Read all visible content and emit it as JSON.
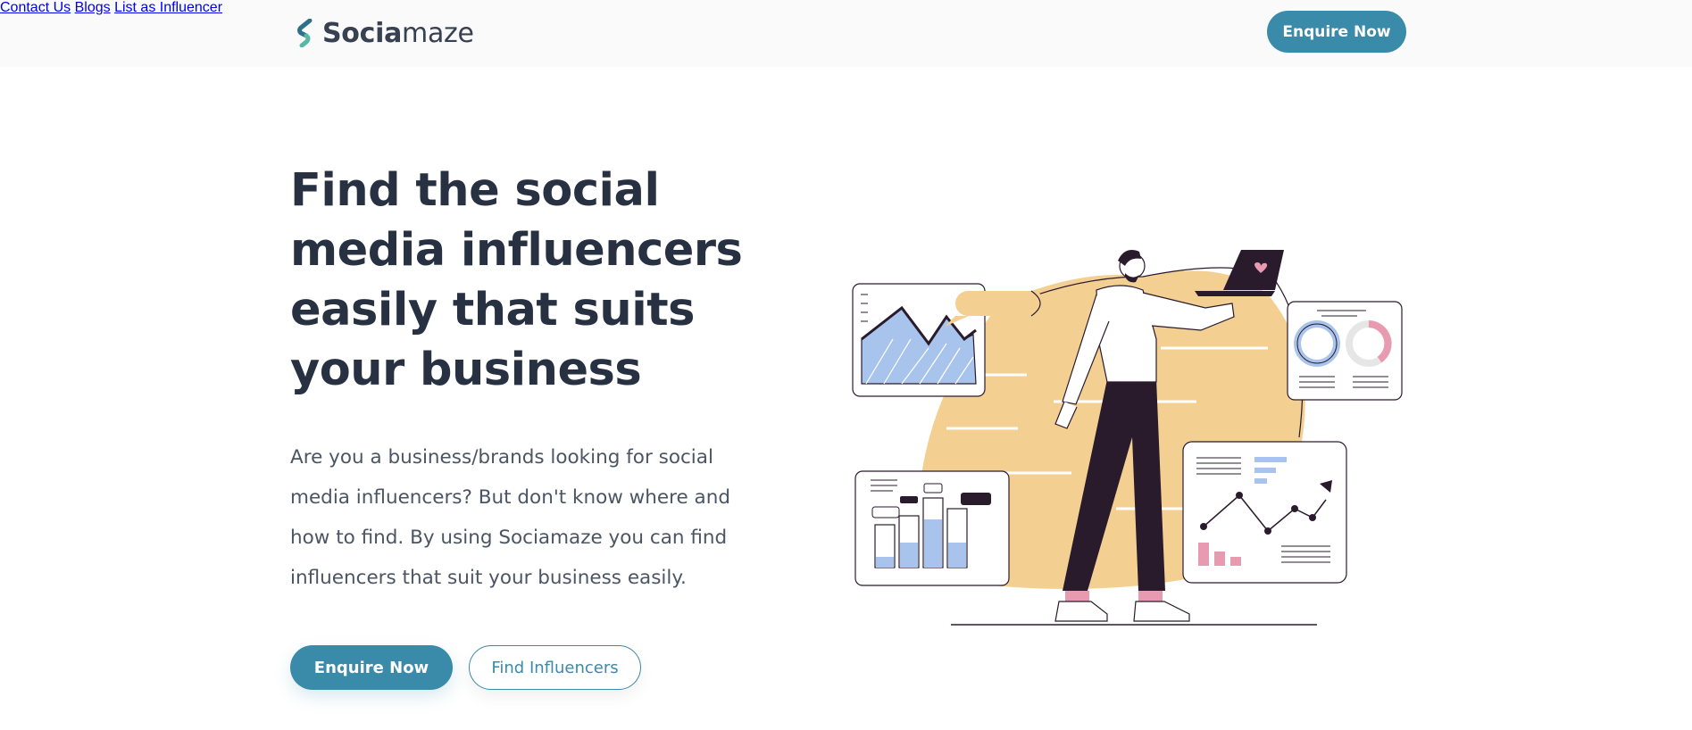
{
  "brand": {
    "name_bold": "Socia",
    "name_light": "maze",
    "accent_color": "#3a8aaa"
  },
  "nav": {
    "items": [
      {
        "label": "Contact Us"
      },
      {
        "label": "Blogs"
      },
      {
        "label": "List as Influencer"
      }
    ],
    "cta_label": "Enquire Now"
  },
  "hero": {
    "title": "Find the social media influencers easily that suits your business",
    "subtitle": "Are you a business/brands looking for social media influencers? But don't know where and how to find. By using Sociamaze you can find influencers that suit your business easily.",
    "primary_button": "Enquire Now",
    "secondary_button": "Find Influencers"
  },
  "illustration": {
    "icon": "person-with-laptop-analytics-illustration",
    "colors": {
      "blob": "#f3cf91",
      "dark": "#2a1b2c",
      "blue": "#a9c4ec",
      "pink": "#e79ab0"
    }
  }
}
